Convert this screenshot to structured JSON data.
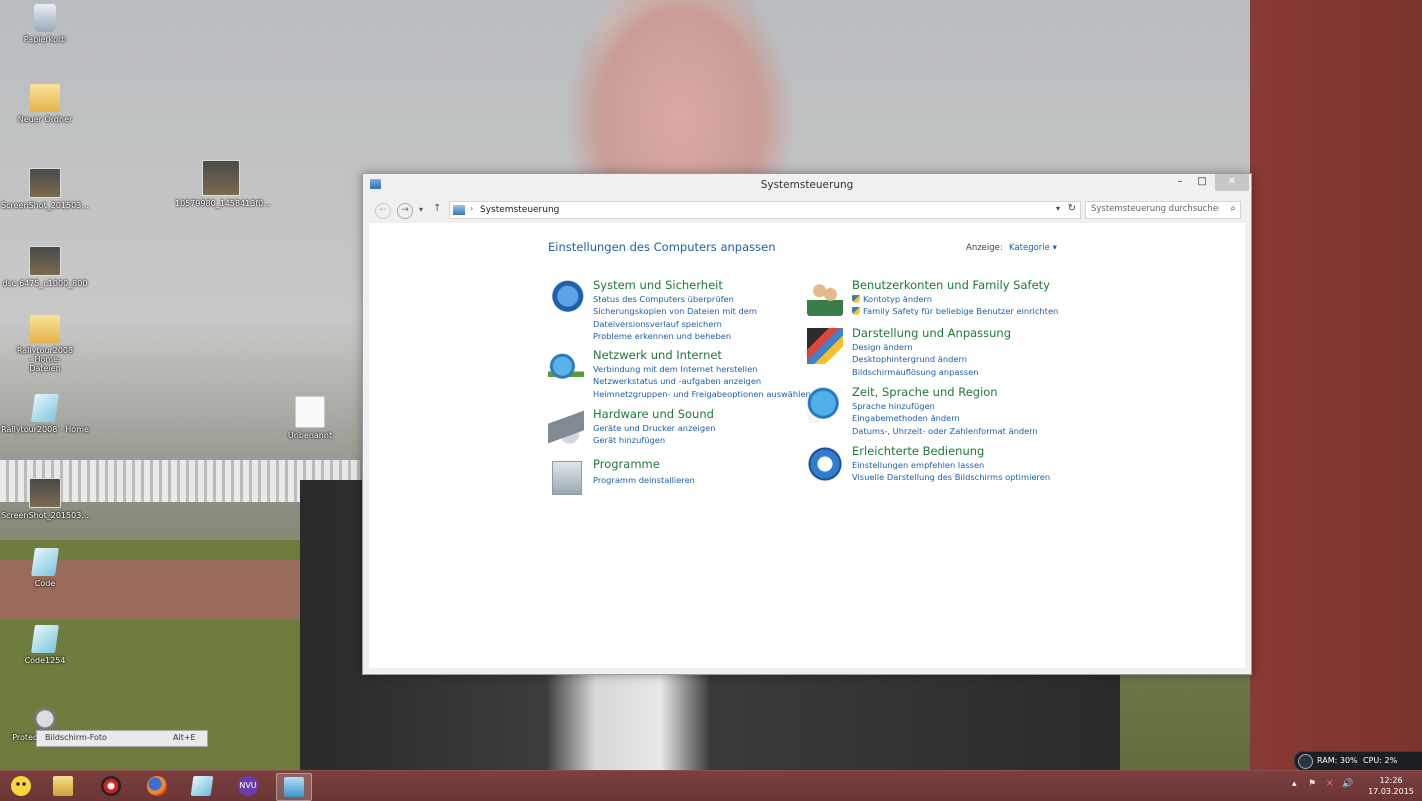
{
  "desktop": {
    "icons": [
      {
        "label": "Papierkorb",
        "icon": "recycle-bin-icon"
      },
      {
        "label": "Neuer Ordner",
        "icon": "folder-icon"
      },
      {
        "label": "ScreenShot_201503...",
        "icon": "image-file-icon"
      },
      {
        "label": "10579980_1458413f0...",
        "icon": "photo-icon"
      },
      {
        "label": "dsc-6475_c1000_800",
        "icon": "photo-icon"
      },
      {
        "label": "Rallytour2008 - Home-Dateien",
        "icon": "folder-icon"
      },
      {
        "label": "Rallytour2008 - Home",
        "icon": "document-icon"
      },
      {
        "label": "Unbenannt",
        "icon": "blank-document-icon"
      },
      {
        "label": "ScreenShot_201503...",
        "icon": "image-file-icon"
      },
      {
        "label": "Code",
        "icon": "document-icon"
      },
      {
        "label": "Code1254",
        "icon": "document-icon"
      },
      {
        "label": "Protected Folder",
        "icon": "lock-folder-icon"
      }
    ],
    "tooltip": {
      "label": "Bildschirm-Foto",
      "shortcut": "Alt+E"
    }
  },
  "window": {
    "title": "Systemsteuerung",
    "controls": {
      "minimize": "–",
      "maximize": "□",
      "close": "✕"
    },
    "nav": {
      "back": "←",
      "forward": "→",
      "recent": "▾",
      "up": "↑",
      "breadcrumb": "Systemsteuerung",
      "dropdown": "▾",
      "refresh": "↻",
      "search_placeholder": "Systemsteuerung durchsuchen",
      "search_icon": "⌕"
    },
    "content": {
      "title": "Einstellungen des Computers anpassen",
      "view_label": "Anzeige:",
      "view_value": "Kategorie ▾",
      "left_categories": [
        {
          "title": "System und Sicherheit",
          "icon": "shield-icon",
          "links": [
            "Status des Computers überprüfen",
            "Sicherungskopien von Dateien mit dem",
            "Dateiversionsverlauf speichern",
            "Probleme erkennen und beheben"
          ]
        },
        {
          "title": "Netzwerk und Internet",
          "icon": "network-globe-icon",
          "links": [
            "Verbindung mit dem Internet herstellen",
            "Netzwerkstatus und -aufgaben anzeigen",
            "Heimnetzgruppen- und Freigabeoptionen auswählen"
          ]
        },
        {
          "title": "Hardware und Sound",
          "icon": "printer-speaker-icon",
          "links": [
            "Geräte und Drucker anzeigen",
            "Gerät hinzufügen"
          ]
        },
        {
          "title": "Programme",
          "icon": "programs-icon",
          "links": [
            "Programm deinstallieren"
          ]
        }
      ],
      "right_categories": [
        {
          "title": "Benutzerkonten und Family Safety",
          "icon": "users-icon",
          "links": [
            "Kontotyp ändern",
            "Family Safety für beliebige Benutzer einrichten"
          ]
        },
        {
          "title": "Darstellung und Anpassung",
          "icon": "display-icon",
          "links": [
            "Design ändern",
            "Desktophintergrund ändern",
            "Bildschirmauflösung anpassen"
          ]
        },
        {
          "title": "Zeit, Sprache und Region",
          "icon": "globe-clock-icon",
          "links": [
            "Sprache hinzufügen",
            "Eingabemethoden ändern",
            "Datums-, Uhrzeit- oder Zahlenformat ändern"
          ]
        },
        {
          "title": "Erleichterte Bedienung",
          "icon": "ease-of-access-icon",
          "links": [
            "Einstellungen empfehlen lassen",
            "Visuelle Darstellung des Bildschirms optimieren"
          ]
        }
      ]
    }
  },
  "taskbar": {
    "items": [
      {
        "name": "smiley-app-icon"
      },
      {
        "name": "file-explorer-icon"
      },
      {
        "name": "gear-app-icon"
      },
      {
        "name": "firefox-icon"
      },
      {
        "name": "document-app-icon"
      },
      {
        "name": "nvu-icon",
        "text": "NVU"
      },
      {
        "name": "control-panel-icon",
        "active": true
      }
    ],
    "monitor": {
      "ram": "RAM: 30%",
      "cpu": "CPU: 2%"
    },
    "tray": {
      "chevron": "▴",
      "flag": "⚑",
      "network": "✕",
      "volume": "🔊"
    },
    "clock": {
      "time": "12:26",
      "date": "17.03.2015"
    }
  }
}
